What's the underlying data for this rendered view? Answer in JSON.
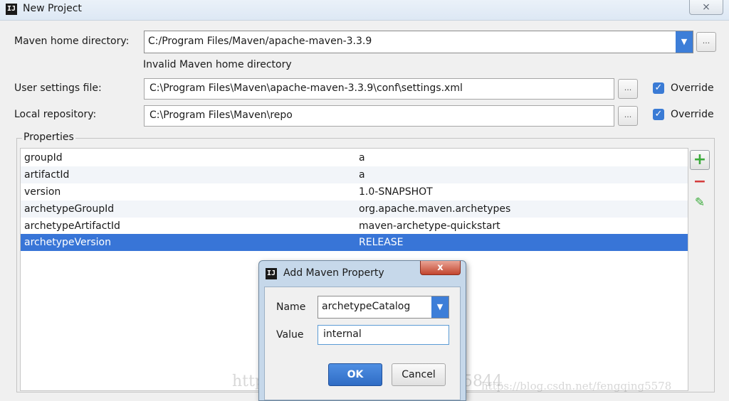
{
  "window": {
    "logo": "IJ",
    "title": "New Project",
    "close_label": "⨯"
  },
  "form": {
    "maven_home_label": "Maven home directory:",
    "maven_home_value": "C:/Program Files/Maven/apache-maven-3.3.9",
    "maven_home_error": "Invalid Maven home directory",
    "user_settings_label": "User settings file:",
    "user_settings_value": "C:\\Program Files\\Maven\\apache-maven-3.3.9\\conf\\settings.xml",
    "local_repo_label": "Local repository:",
    "local_repo_value": "C:\\Program Files\\Maven\\repo",
    "override_label": "Override",
    "browse_label": "..."
  },
  "properties": {
    "title": "Properties",
    "rows": [
      {
        "key": "groupId",
        "value": "a"
      },
      {
        "key": "artifactId",
        "value": "a"
      },
      {
        "key": "version",
        "value": "1.0-SNAPSHOT"
      },
      {
        "key": "archetypeGroupId",
        "value": "org.apache.maven.archetypes"
      },
      {
        "key": "archetypeArtifactId",
        "value": "maven-archetype-quickstart"
      },
      {
        "key": "archetypeVersion",
        "value": "RELEASE"
      }
    ],
    "selected_row": "archetypeVersion",
    "add_label": "+",
    "remove_label": "−",
    "edit_label": "✎"
  },
  "dialog": {
    "logo": "IJ",
    "title": "Add Maven Property",
    "close_label": "x",
    "name_label": "Name",
    "name_value": "archetypeCatalog",
    "value_label": "Value",
    "value_value": "internal",
    "ok_label": "OK",
    "cancel_label": "Cancel"
  },
  "watermarks": {
    "center": "http://blog.csdn.net/u1070335844",
    "right": "https://blog.csdn.net/fengqing5578"
  }
}
